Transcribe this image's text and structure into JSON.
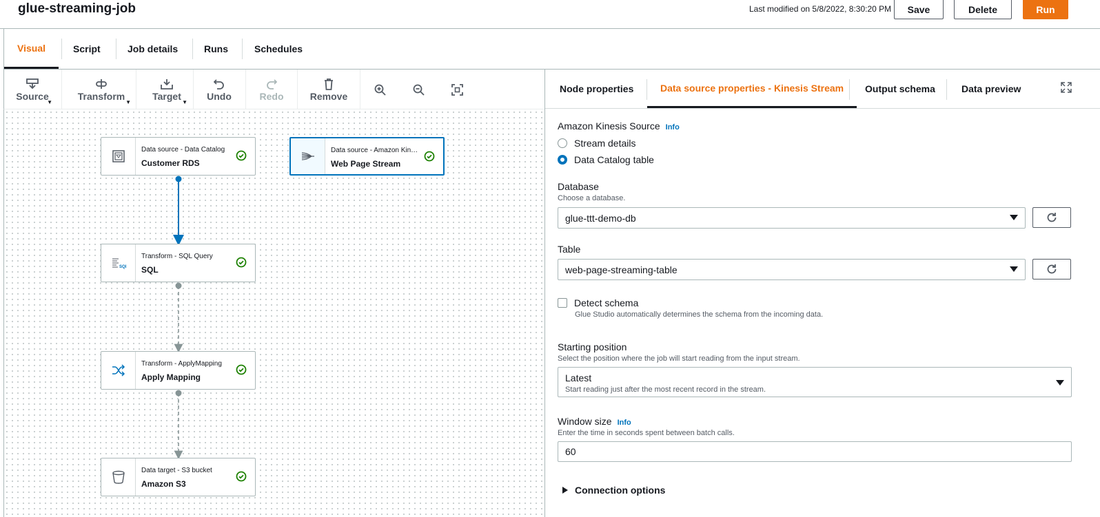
{
  "header": {
    "job_name": "glue-streaming-job",
    "last_modified": "Last modified on 5/8/2022, 8:30:20 PM",
    "save_label": "Save",
    "delete_label": "Delete",
    "run_label": "Run"
  },
  "tabs": [
    "Visual",
    "Script",
    "Job details",
    "Runs",
    "Schedules"
  ],
  "toolbar": {
    "source": "Source",
    "transform": "Transform",
    "target": "Target",
    "undo": "Undo",
    "redo": "Redo",
    "remove": "Remove",
    "icons": [
      "zoom-in-icon",
      "zoom-out-icon",
      "fit-to-screen-icon"
    ]
  },
  "nodes": [
    {
      "type": "Data source - Data Catalog",
      "name": "Customer RDS"
    },
    {
      "type": "Data source - Amazon Kinesis",
      "name": "Web Page Stream"
    },
    {
      "type": "Transform - SQL Query",
      "name": "SQL"
    },
    {
      "type": "Transform - ApplyMapping",
      "name": "Apply Mapping"
    },
    {
      "type": "Data target - S3 bucket",
      "name": "Amazon S3"
    }
  ],
  "panel": {
    "tabs": [
      "Node properties",
      "Data source properties - Kinesis Stream",
      "Output schema",
      "Data preview"
    ],
    "kinesis_source_label": "Amazon Kinesis Source",
    "info": "Info",
    "radio_stream_details": "Stream details",
    "radio_catalog_table": "Data Catalog table",
    "selected_radio": "Data Catalog table",
    "database_label": "Database",
    "database_desc": "Choose a database.",
    "database_value": "glue-ttt-demo-db",
    "table_label": "Table",
    "table_value": "web-page-streaming-table",
    "detect_schema_label": "Detect schema",
    "detect_schema_desc": "Glue Studio automatically determines the schema from the incoming data.",
    "detect_schema_checked": false,
    "starting_position_label": "Starting position",
    "starting_position_desc": "Select the position where the job will start reading from the input stream.",
    "starting_position_value": "Latest",
    "starting_position_value_desc": "Start reading just after the most recent record in the stream.",
    "window_size_label": "Window size",
    "window_size_desc": "Enter the time in seconds spent between batch calls.",
    "window_size_value": "60",
    "connection_options": "Connection options"
  },
  "colors": {
    "accent": "#ec7211",
    "link": "#0073bb",
    "success": "#1d8102"
  }
}
